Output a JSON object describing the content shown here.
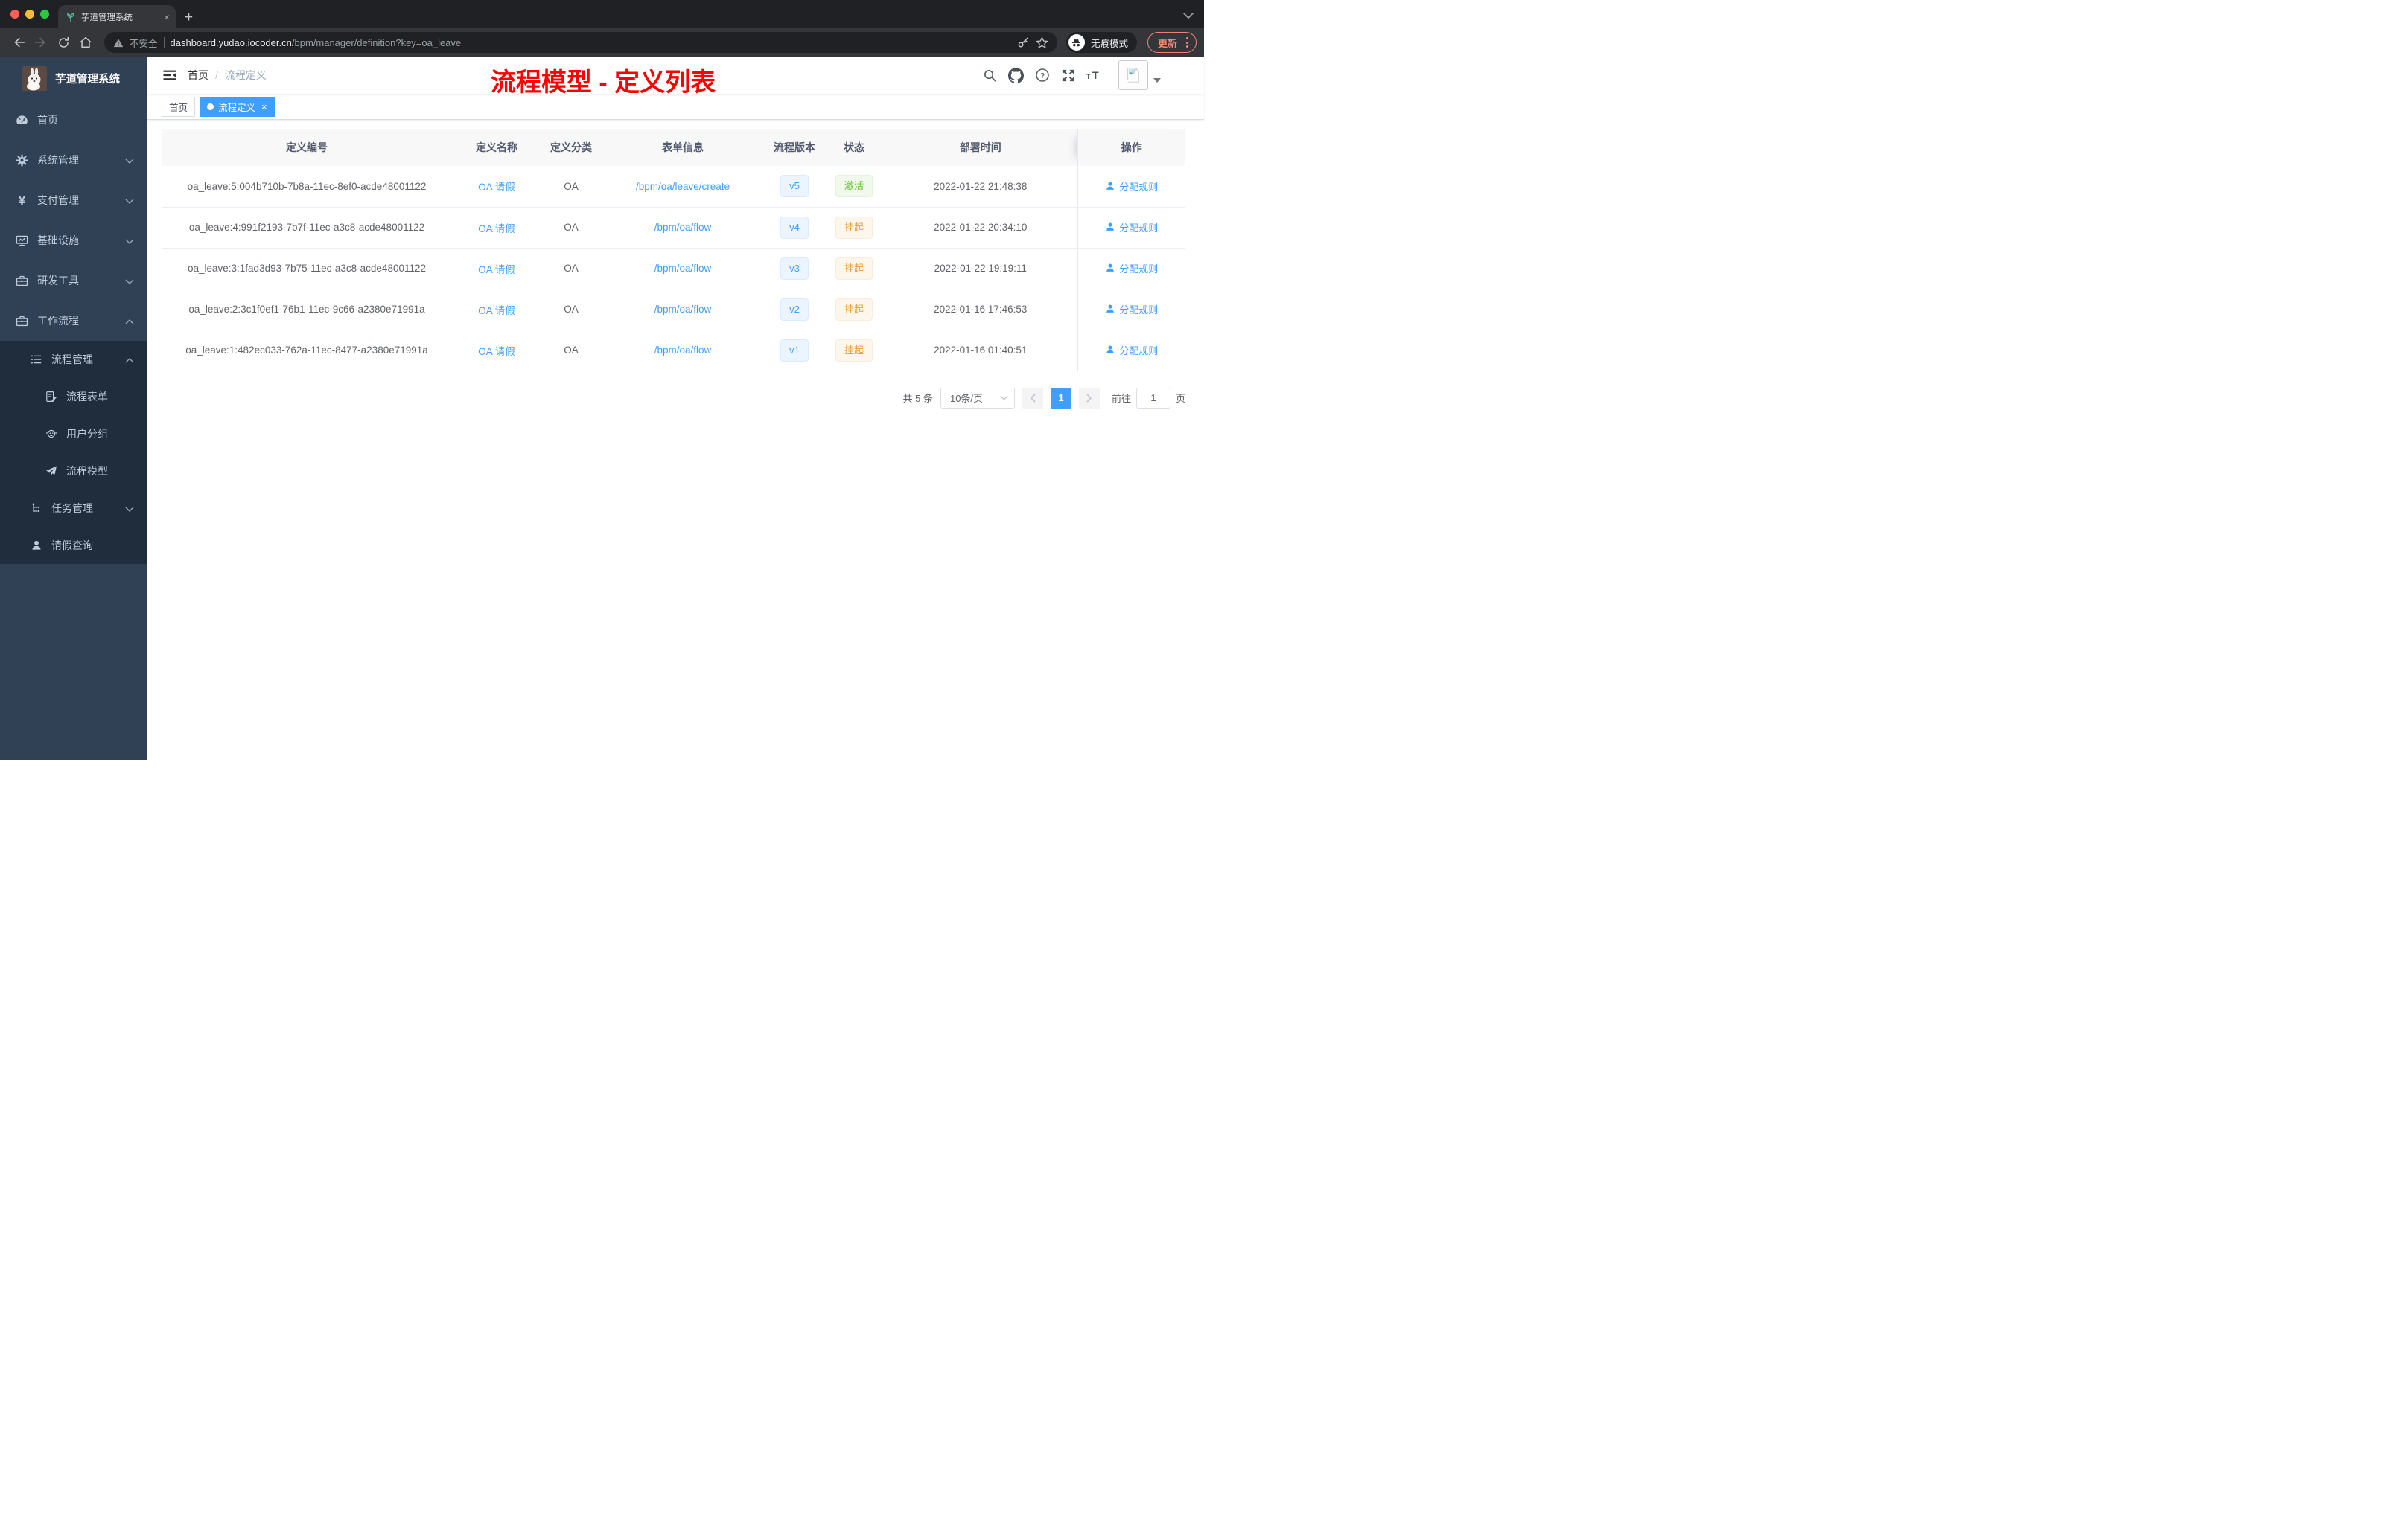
{
  "browser": {
    "tab": {
      "title": "芋道管理系统",
      "close": "×",
      "new_tab": "+"
    },
    "toolbar": {
      "security_label": "不安全",
      "url_domain": "dashboard.yudao.iocoder.cn",
      "url_path": "/bpm/manager/definition?key=oa_leave",
      "incognito_label": "无痕模式",
      "update_label": "更新"
    }
  },
  "sidebar": {
    "logo_title": "芋道管理系统",
    "items": [
      {
        "label": "首页",
        "icon": "dashboard-icon"
      },
      {
        "label": "系统管理",
        "icon": "gear-icon"
      },
      {
        "label": "支付管理",
        "icon": "yen-icon"
      },
      {
        "label": "基础设施",
        "icon": "monitor-icon"
      },
      {
        "label": "研发工具",
        "icon": "toolbox-icon"
      },
      {
        "label": "工作流程",
        "icon": "briefcase-icon"
      }
    ],
    "submenu": [
      {
        "label": "流程管理",
        "icon": "list-icon"
      },
      {
        "label": "流程表单",
        "icon": "form-icon"
      },
      {
        "label": "用户分组",
        "icon": "group-icon"
      },
      {
        "label": "流程模型",
        "icon": "send-icon"
      },
      {
        "label": "任务管理",
        "icon": "tree-icon"
      },
      {
        "label": "请假查询",
        "icon": "user-icon"
      }
    ]
  },
  "navbar": {
    "breadcrumb_home": "首页",
    "breadcrumb_separator": "/",
    "breadcrumb_current": "流程定义"
  },
  "annotation": {
    "text": "流程模型 - 定义列表",
    "color": "#ff0000"
  },
  "tags_view": {
    "home_tag": "首页",
    "active_tag": "流程定义",
    "close": "×"
  },
  "table": {
    "headers": [
      "定义编号",
      "定义名称",
      "定义分类",
      "表单信息",
      "流程版本",
      "状态",
      "部署时间",
      "操作"
    ],
    "rows": [
      {
        "id": "oa_leave:5:004b710b-7b8a-11ec-8ef0-acde48001122",
        "name": "OA 请假",
        "category": "OA",
        "form": "/bpm/oa/leave/create",
        "version": "v5",
        "status": "激活",
        "status_type": "success",
        "deploy_time": "2022-01-22 21:48:38",
        "action": "分配规则"
      },
      {
        "id": "oa_leave:4:991f2193-7b7f-11ec-a3c8-acde48001122",
        "name": "OA 请假",
        "category": "OA",
        "form": "/bpm/oa/flow",
        "version": "v4",
        "status": "挂起",
        "status_type": "warning",
        "deploy_time": "2022-01-22 20:34:10",
        "action": "分配规则"
      },
      {
        "id": "oa_leave:3:1fad3d93-7b75-11ec-a3c8-acde48001122",
        "name": "OA 请假",
        "category": "OA",
        "form": "/bpm/oa/flow",
        "version": "v3",
        "status": "挂起",
        "status_type": "warning",
        "deploy_time": "2022-01-22 19:19:11",
        "action": "分配规则"
      },
      {
        "id": "oa_leave:2:3c1f0ef1-76b1-11ec-9c66-a2380e71991a",
        "name": "OA 请假",
        "category": "OA",
        "form": "/bpm/oa/flow",
        "version": "v2",
        "status": "挂起",
        "status_type": "warning",
        "deploy_time": "2022-01-16 17:46:53",
        "action": "分配规则"
      },
      {
        "id": "oa_leave:1:482ec033-762a-11ec-8477-a2380e71991a",
        "name": "OA 请假",
        "category": "OA",
        "form": "/bpm/oa/flow",
        "version": "v1",
        "status": "挂起",
        "status_type": "warning",
        "deploy_time": "2022-01-16 01:40:51",
        "action": "分配规则"
      }
    ]
  },
  "pagination": {
    "total_text": "共 5 条",
    "page_size": "10条/页",
    "current_page": "1",
    "goto_label": "前往",
    "goto_value": "1",
    "page_unit": "页"
  },
  "colors": {
    "accent": "#409eff",
    "sidebar_bg": "#304156",
    "submenu_bg": "#1f2d3d",
    "annotation": "#ff0000",
    "success": "#67c23a",
    "warning": "#e6a23c"
  }
}
